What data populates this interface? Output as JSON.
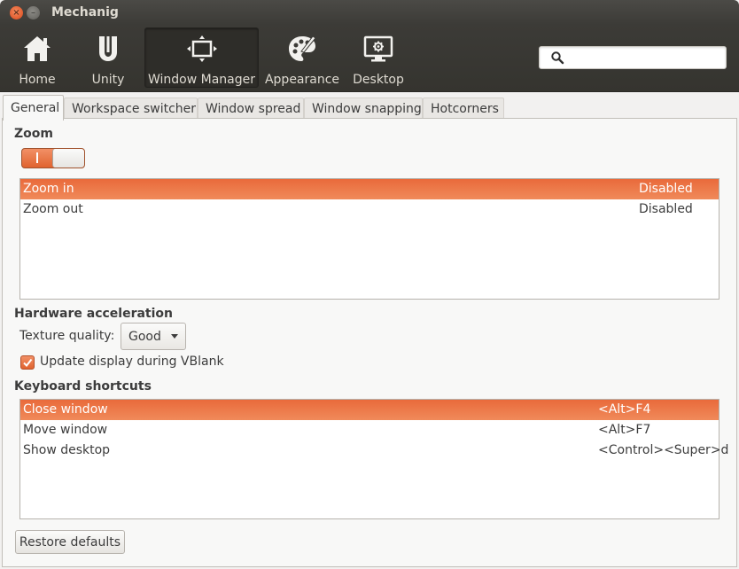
{
  "window": {
    "title": "Mechanig",
    "close_glyph": "×",
    "min_glyph": "–"
  },
  "toolbar": {
    "items": [
      {
        "label": "Home",
        "icon": "home-icon"
      },
      {
        "label": "Unity",
        "icon": "unity-icon"
      },
      {
        "label": "Window Manager",
        "icon": "window-manager-icon",
        "active": true
      },
      {
        "label": "Appearance",
        "icon": "appearance-icon"
      },
      {
        "label": "Desktop",
        "icon": "desktop-icon"
      }
    ],
    "search": {
      "value": "",
      "placeholder": ""
    }
  },
  "tabs": [
    {
      "label": "General",
      "active": true
    },
    {
      "label": "Workspace switcher"
    },
    {
      "label": "Window spread"
    },
    {
      "label": "Window snapping"
    },
    {
      "label": "Hotcorners"
    }
  ],
  "zoom": {
    "heading": "Zoom",
    "switch_on": true,
    "rows": [
      {
        "action": "Zoom in",
        "value": "Disabled",
        "selected": true
      },
      {
        "action": "Zoom out",
        "value": "Disabled"
      }
    ]
  },
  "hardware": {
    "heading": "Hardware acceleration",
    "texture_label": "Texture quality:",
    "texture_value": "Good",
    "vblank_label": "Update display during VBlank",
    "vblank_checked": true
  },
  "shortcuts": {
    "heading": "Keyboard shortcuts",
    "rows": [
      {
        "action": "Close window",
        "keys": "<Alt>F4",
        "selected": true
      },
      {
        "action": "Move window",
        "keys": "<Alt>F7"
      },
      {
        "action": "Show desktop",
        "keys": "<Control><Super>d"
      }
    ]
  },
  "restore_label": "Restore defaults",
  "colors": {
    "accent": "#e9673a",
    "toolbar_bg": "#3c3b37",
    "text": "#3c3c3c"
  }
}
